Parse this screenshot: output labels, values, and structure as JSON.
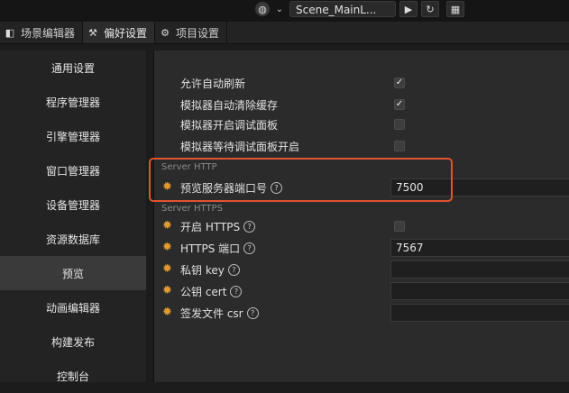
{
  "toolbar": {
    "scene_name": "Scene_MainL...",
    "colors": {
      "accent": "#e0542e",
      "gear": "#e39b2f"
    }
  },
  "tabs": [
    {
      "label": "场景编辑器",
      "icon": "scene-editor-icon"
    },
    {
      "label": "偏好设置",
      "icon": "wrench-icon"
    },
    {
      "label": "项目设置",
      "icon": "gear-icon"
    }
  ],
  "sidebar": {
    "items": [
      {
        "label": "通用设置"
      },
      {
        "label": "程序管理器"
      },
      {
        "label": "引擎管理器"
      },
      {
        "label": "窗口管理器"
      },
      {
        "label": "设备管理器"
      },
      {
        "label": "资源数据库"
      },
      {
        "label": "预览"
      },
      {
        "label": "动画编辑器"
      },
      {
        "label": "构建发布"
      },
      {
        "label": "控制台"
      }
    ],
    "selected": "预览"
  },
  "settings": {
    "auto_refresh": {
      "label": "允许自动刷新",
      "checked": true
    },
    "sim_clear_cache": {
      "label": "模拟器自动清除缓存",
      "checked": true
    },
    "sim_debug_panel": {
      "label": "模拟器开启调试面板",
      "checked": false
    },
    "sim_wait_debug": {
      "label": "模拟器等待调试面板开启",
      "checked": false
    },
    "section_http": "Server HTTP",
    "preview_port": {
      "label": "预览服务器端口号",
      "value": "7500"
    },
    "section_https": "Server HTTPS",
    "enable_https": {
      "label": "开启 HTTPS",
      "checked": false
    },
    "https_port": {
      "label": "HTTPS 端口",
      "value": "7567"
    },
    "private_key": {
      "label": "私钥 key",
      "value": ""
    },
    "public_cert": {
      "label": "公钥 cert",
      "value": ""
    },
    "csr_file": {
      "label": "签发文件 csr",
      "value": ""
    }
  }
}
